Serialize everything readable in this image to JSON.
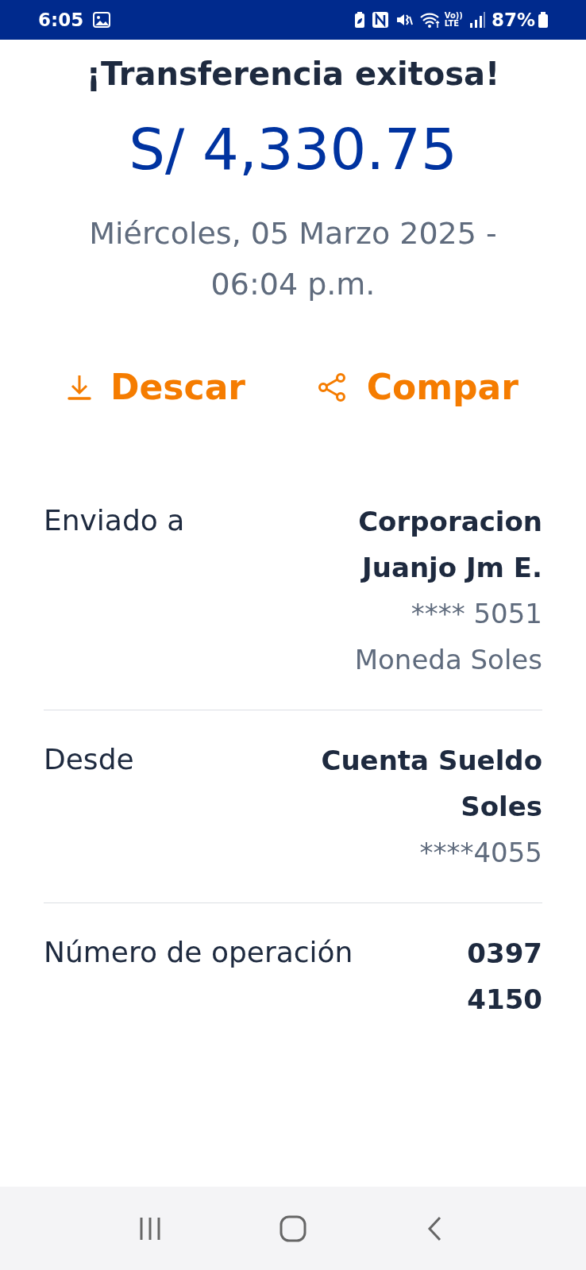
{
  "status_bar": {
    "time": "6:05",
    "network": [
      "Vo))",
      "LTE"
    ],
    "battery": "87%"
  },
  "title": "¡Transferencia exitosa!",
  "amount": "S/ 4,330.75",
  "date": "Miércoles, 05 Marzo 2025 - 06:04 p.m.",
  "actions": [
    {
      "kind": "download",
      "label": "Descar"
    },
    {
      "kind": "share",
      "label": "Compar"
    }
  ],
  "details": [
    {
      "label": "Enviado a",
      "lines": [
        {
          "kind": "strong",
          "text": "Corporacion Juanjo Jm E."
        },
        {
          "kind": "muted",
          "text": "**** 5051"
        },
        {
          "kind": "muted",
          "text": "Moneda Soles"
        }
      ]
    },
    {
      "label": "Desde",
      "lines": [
        {
          "kind": "strong",
          "text": "Cuenta Sueldo Soles"
        },
        {
          "kind": "muted",
          "text": "****4055"
        }
      ]
    },
    {
      "label": "Número de operación",
      "lines": [
        {
          "kind": "strong",
          "text": "0397 4150"
        }
      ]
    }
  ]
}
